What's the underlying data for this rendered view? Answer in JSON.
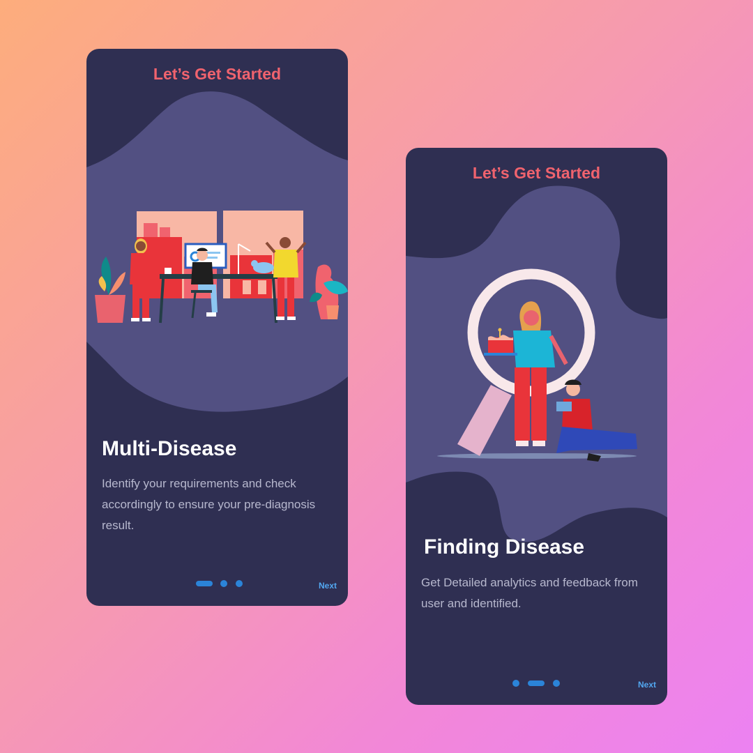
{
  "screens": [
    {
      "header": "Let’s Get Started",
      "title": "Multi-Disease",
      "description": "Identify your requirements and check accordingly to ensure your pre-diagnosis result.",
      "next_label": "Next",
      "pagination": {
        "count": 3,
        "active_index": 0
      },
      "illustration": "office-team-illustration"
    },
    {
      "header": "Let’s Get Started",
      "title": "Finding Disease",
      "description": "Get Detailed analytics and feedback from user and identified.",
      "next_label": "Next",
      "pagination": {
        "count": 3,
        "active_index": 1
      },
      "illustration": "magnifying-glass-people-illustration"
    }
  ],
  "colors": {
    "background_gradient": [
      "#fdad7c",
      "#f69ab0",
      "#ec82f2"
    ],
    "card": "#2f2f52",
    "blob": "#525082",
    "header": "#f0636e",
    "title": "#ffffff",
    "description": "#b7b8ce",
    "pagination": "#2b84d8",
    "next": "#52a7f0"
  }
}
